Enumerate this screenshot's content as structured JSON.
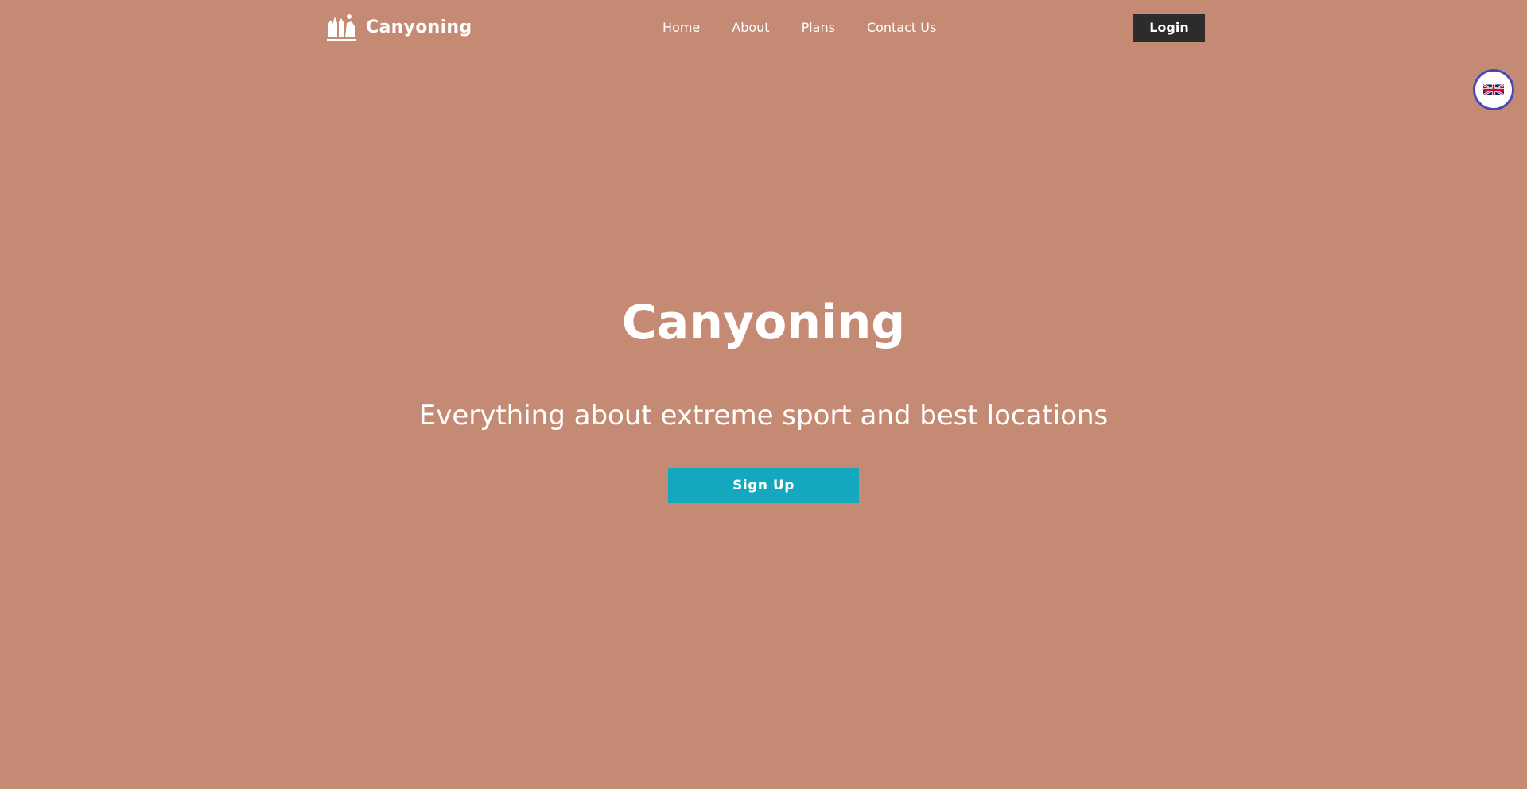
{
  "header": {
    "logo_text": "Canyoning",
    "logo_icon": "canyon-logo-icon",
    "nav": [
      {
        "label": "Home"
      },
      {
        "label": "About"
      },
      {
        "label": "Plans"
      },
      {
        "label": "Contact Us"
      }
    ],
    "login_label": "Login"
  },
  "language_switcher": {
    "icon": "uk-flag-icon"
  },
  "hero": {
    "title": "Canyoning",
    "subtitle": "Everything about extreme sport and best locations",
    "signup_label": "Sign Up"
  },
  "colors": {
    "background": "#c48a74",
    "login_button": "#2c2c2c",
    "signup_button": "#14a8bf",
    "language_border": "#4a48b8",
    "text": "#ffffff"
  }
}
